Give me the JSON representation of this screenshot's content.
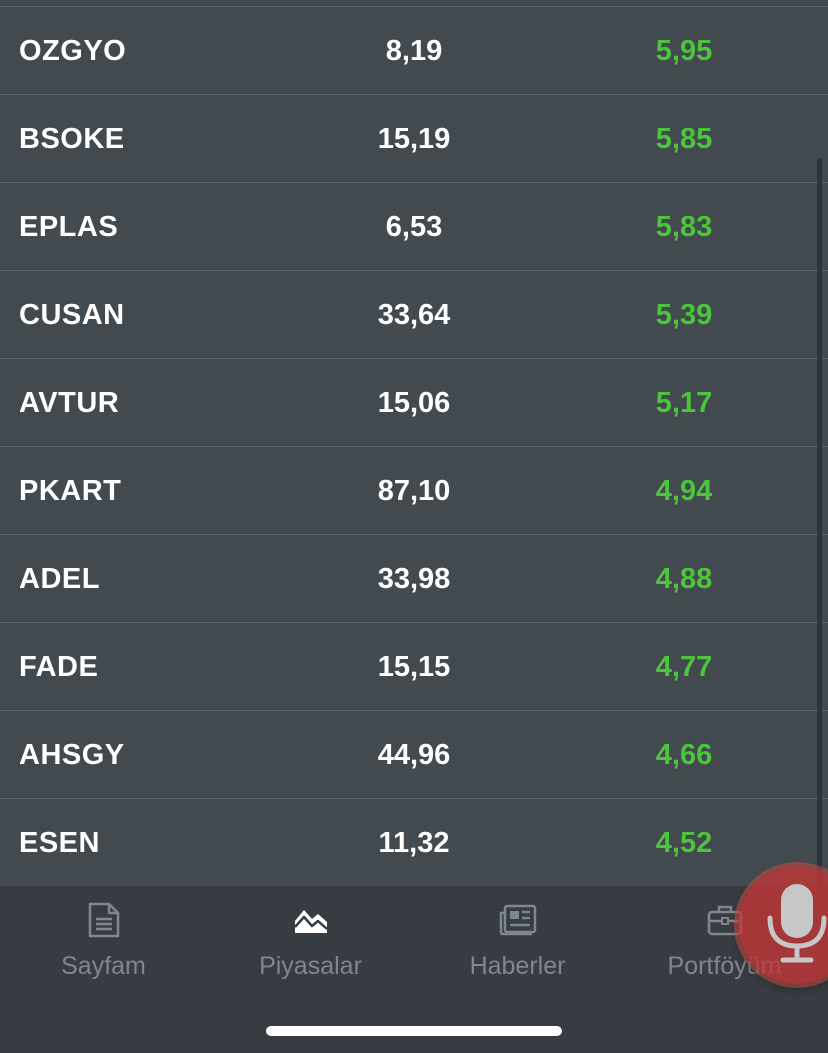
{
  "stocks": [
    {
      "symbol": "OZGYO",
      "price": "8,19",
      "change": "5,95"
    },
    {
      "symbol": "BSOKE",
      "price": "15,19",
      "change": "5,85"
    },
    {
      "symbol": "EPLAS",
      "price": "6,53",
      "change": "5,83"
    },
    {
      "symbol": "CUSAN",
      "price": "33,64",
      "change": "5,39"
    },
    {
      "symbol": "AVTUR",
      "price": "15,06",
      "change": "5,17"
    },
    {
      "symbol": "PKART",
      "price": "87,10",
      "change": "4,94"
    },
    {
      "symbol": "ADEL",
      "price": "33,98",
      "change": "4,88"
    },
    {
      "symbol": "FADE",
      "price": "15,15",
      "change": "4,77"
    },
    {
      "symbol": "AHSGY",
      "price": "44,96",
      "change": "4,66"
    },
    {
      "symbol": "ESEN",
      "price": "11,32",
      "change": "4,52"
    }
  ],
  "tab_bar": {
    "tabs": [
      {
        "label": "Sayfam",
        "icon": "document-icon"
      },
      {
        "label": "Piyasalar",
        "icon": "market-chart-icon"
      },
      {
        "label": "Haberler",
        "icon": "newspaper-icon"
      },
      {
        "label": "Portföyüm",
        "icon": "briefcase-icon"
      }
    ]
  },
  "voice_button": {
    "icon": "microphone-icon"
  },
  "colors": {
    "background": "#424a50",
    "tab_bar": "#363c41",
    "positive_change": "#4cc43c",
    "inactive_tab": "#7f878c",
    "active_tab_icon": "#ffffff",
    "mic_button": "#c43636"
  }
}
